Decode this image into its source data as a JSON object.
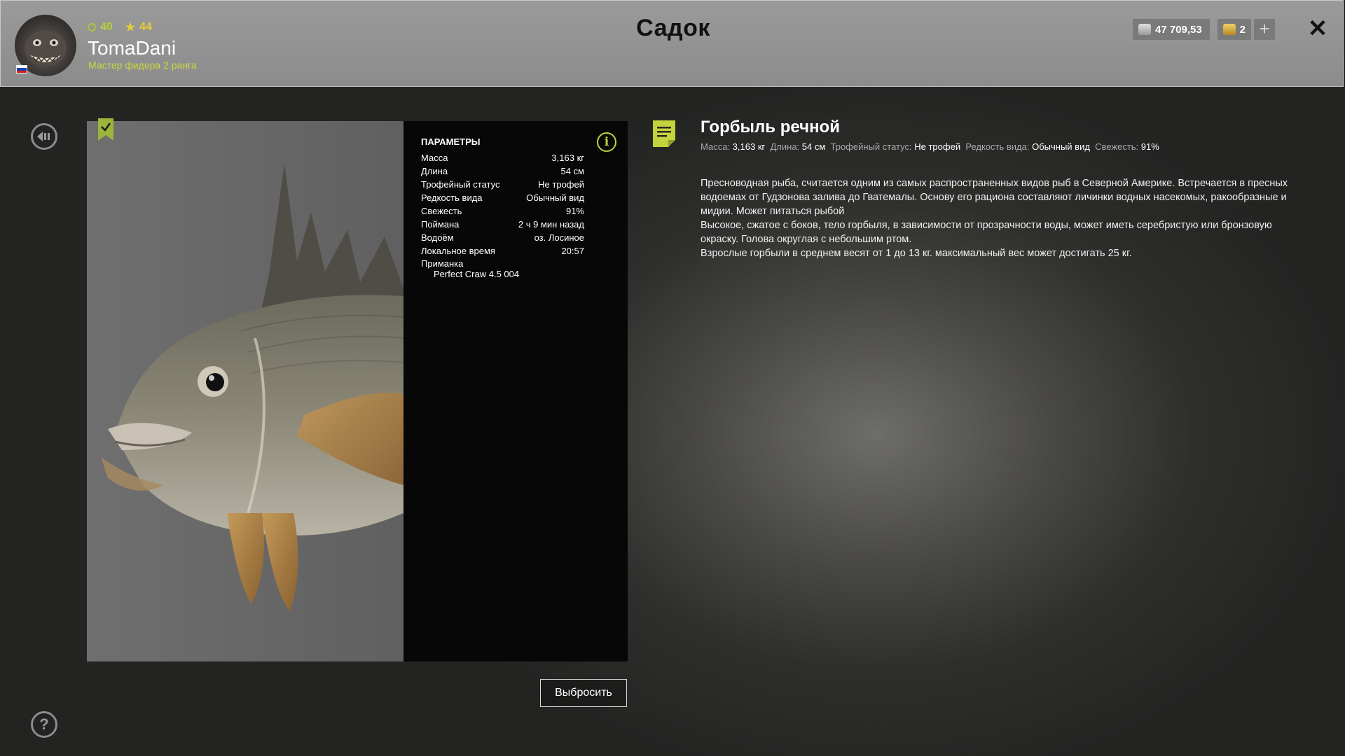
{
  "header": {
    "player_level": "40",
    "player_stars": "44",
    "username": "TomaDani",
    "rank": "Мастер фидера 2 ранга",
    "page_title": "Садок",
    "silver_balance": "47 709,53",
    "gold_balance": "2",
    "plus_label": "+",
    "close_label": "✕"
  },
  "params": {
    "title": "Параметры",
    "rows": [
      {
        "label": "Масса",
        "value": "3,163 кг"
      },
      {
        "label": "Длина",
        "value": "54 см"
      },
      {
        "label": "Трофейный статус",
        "value": "Не трофей"
      },
      {
        "label": "Редкость вида",
        "value": "Обычный вид"
      },
      {
        "label": "Свежесть",
        "value": "91%"
      },
      {
        "label": "Поймана",
        "value": "2 ч 9 мин назад"
      },
      {
        "label": "Водоём",
        "value": "оз. Лосиное"
      },
      {
        "label": "Локальное время",
        "value": "20:57"
      }
    ],
    "bait_label": "Приманка",
    "bait_value": "Perfect Craw 4.5 004"
  },
  "actions": {
    "release_label": "Выбросить"
  },
  "fish": {
    "name": "Горбыль речной",
    "stats": {
      "mass_label": "Масса:",
      "mass_value": "3,163 кг",
      "length_label": "Длина:",
      "length_value": "54 см",
      "trophy_label": "Трофейный статус:",
      "trophy_value": "Не трофей",
      "rarity_label": "Редкость вида:",
      "rarity_value": "Обычный вид",
      "freshness_label": "Свежесть:",
      "freshness_value": "91%"
    },
    "description": [
      "Пресноводная рыба, считается одним из самых распространенных видов рыб в Северной Америке. Встречается в пресных водоемах от Гудзонова залива до Гватемалы. Основу его рациона составляют личинки водных насекомых, ракообразные и мидии. Может питаться рыбой",
      "Высокое, сжатое с боков, тело горбыля, в зависимости от прозрачности воды, может иметь серебристую или бронзовую окраску. Голова округлая с небольшим ртом.",
      "Взрослые горбыли в среднем весят от 1 до 13 кг. максимальный вес может достигать 25 кг."
    ]
  },
  "colors": {
    "accent": "#c3d33c",
    "rank_text": "#c8d93f",
    "header_bg": "#949494",
    "panel_bg": "#070707"
  },
  "icons": {
    "back": "back-arrow-icon",
    "help": "question-icon",
    "info": "info-icon",
    "document": "document-icon",
    "bookmark": "bookmark-check-icon",
    "silver": "silver-coin-icon",
    "gold": "gold-coin-icon",
    "close": "close-icon"
  }
}
